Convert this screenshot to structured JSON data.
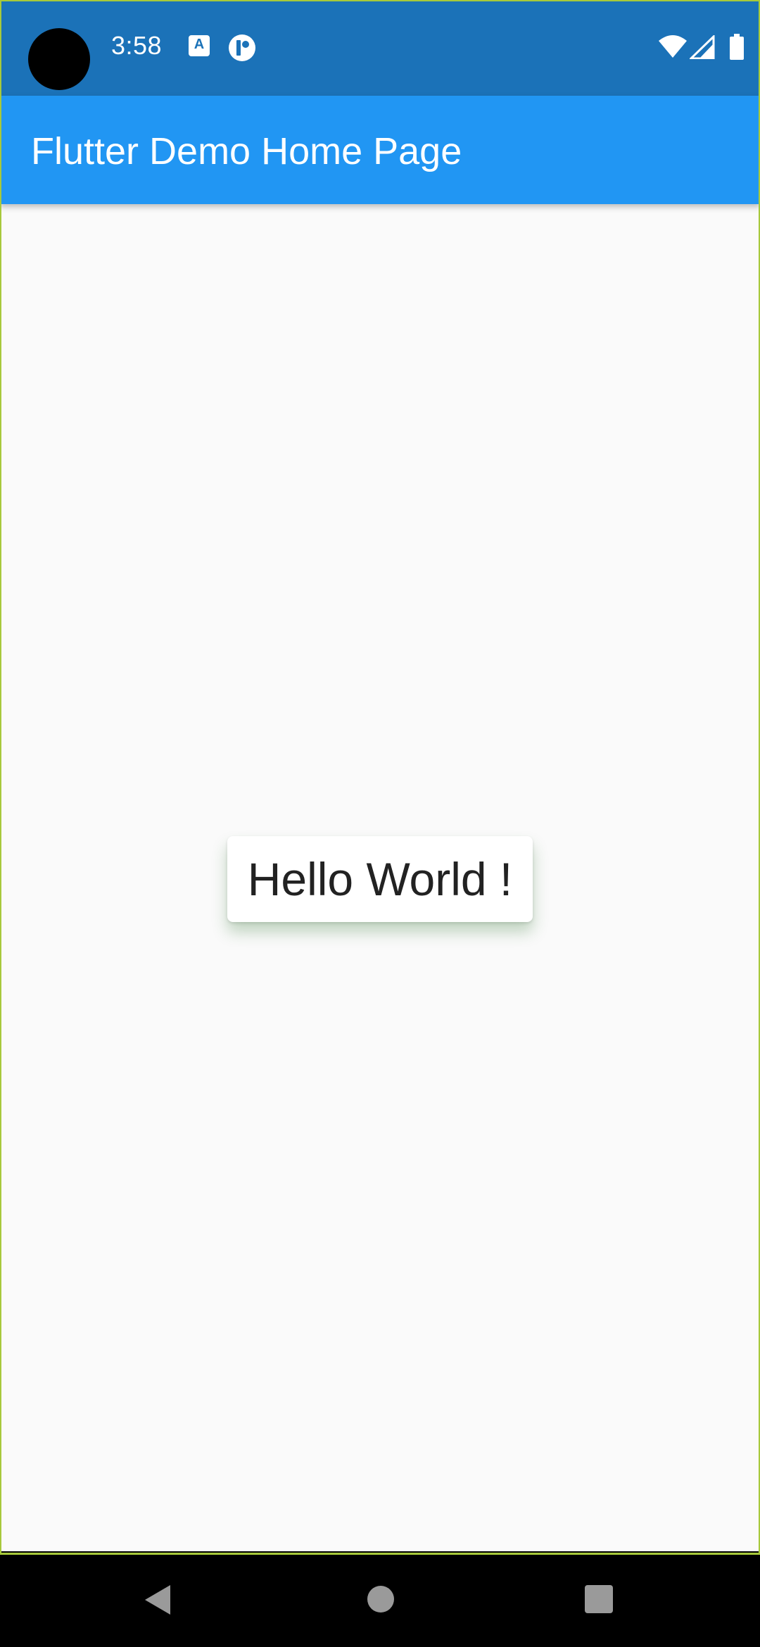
{
  "status_bar": {
    "time": "3:58",
    "notification_icons": [
      "accessibility-text-icon",
      "app-notification-icon"
    ],
    "system_icons": [
      "wifi-icon",
      "cell-signal-icon",
      "battery-icon"
    ],
    "background_color": "#1b72b8"
  },
  "app_bar": {
    "title": "Flutter Demo Home Page",
    "background_color": "#2196f3"
  },
  "main": {
    "card": {
      "text": "Hello World !"
    },
    "background_color": "#fafafa"
  },
  "nav_bar": {
    "buttons": [
      "back-icon",
      "home-icon",
      "recents-icon"
    ]
  }
}
